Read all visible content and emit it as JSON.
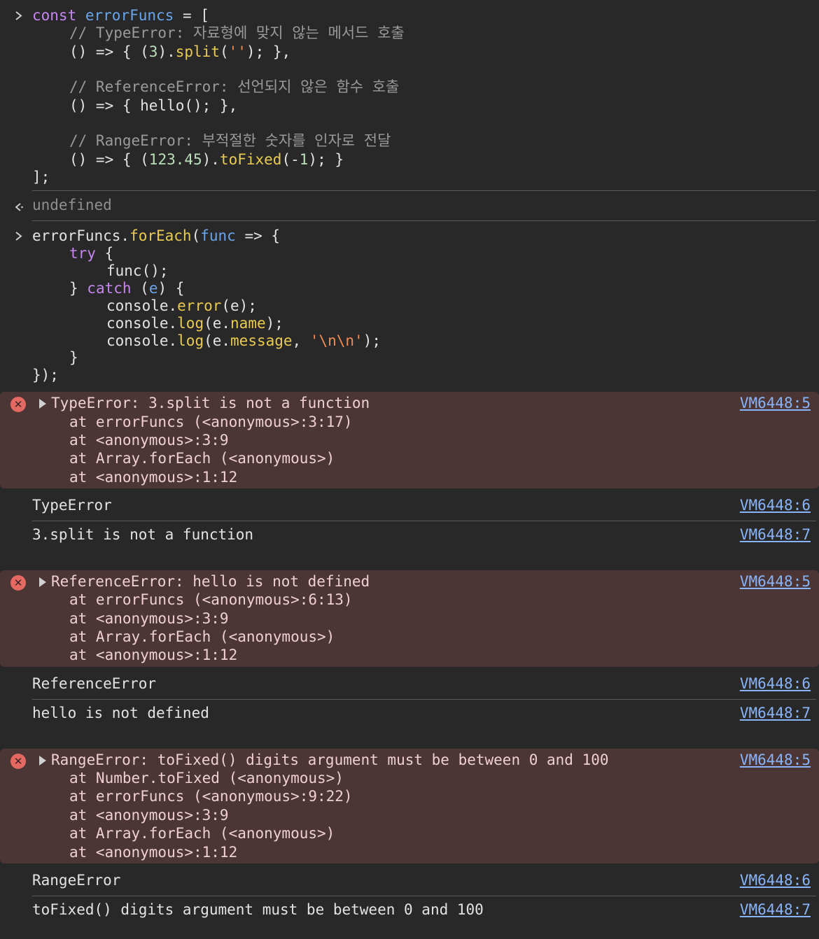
{
  "input1": {
    "const_kw": "const",
    "var_name": "errorFuncs",
    "assign": " = [",
    "comment1": "// TypeError: 자료형에 맞지 않는 메서드 호출",
    "line1_a": "() => { (",
    "line1_num": "3",
    "line1_b": ").",
    "line1_fn": "split",
    "line1_c": "(",
    "line1_str": "''",
    "line1_d": "); },",
    "comment2": "// ReferenceError: 선언되지 않은 함수 호출",
    "line2": "() => { hello(); },",
    "comment3": "// RangeError: 부적절한 숫자를 인자로 전달",
    "line3_a": "() => { (",
    "line3_num": "123.45",
    "line3_b": ").",
    "line3_fn": "toFixed",
    "line3_c": "(-",
    "line3_num2": "1",
    "line3_d": "); }",
    "close": "];"
  },
  "result1": "undefined",
  "input2": {
    "l1_a": "errorFuncs.",
    "l1_fn": "forEach",
    "l1_b": "(",
    "l1_var": "func",
    "l1_c": " => {",
    "l2_kw": "try",
    "l2_b": " {",
    "l3": "func();",
    "l4_a": "} ",
    "l4_kw": "catch",
    "l4_b": " (",
    "l4_var": "e",
    "l4_c": ") {",
    "l5_a": "console.",
    "l5_fn": "error",
    "l5_b": "(e);",
    "l6_a": "console.",
    "l6_fn": "log",
    "l6_b": "(e.",
    "l6_prop": "name",
    "l6_c": ");",
    "l7_a": "console.",
    "l7_fn": "log",
    "l7_b": "(e.",
    "l7_prop": "message",
    "l7_c": ", ",
    "l7_str": "'\\n\\n'",
    "l7_d": ");",
    "l8": "}",
    "l9": "});"
  },
  "errors": [
    {
      "title": "TypeError: 3.split is not a function",
      "stack": [
        "at errorFuncs (<anonymous>:3:17)",
        "at <anonymous>:3:9",
        "at Array.forEach (<anonymous>)",
        "at <anonymous>:1:12"
      ],
      "source": "VM6448:5",
      "name_log": "TypeError",
      "name_source": "VM6448:6",
      "message_log": "3.split is not a function",
      "message_source": "VM6448:7"
    },
    {
      "title": "ReferenceError: hello is not defined",
      "stack": [
        "at errorFuncs (<anonymous>:6:13)",
        "at <anonymous>:3:9",
        "at Array.forEach (<anonymous>)",
        "at <anonymous>:1:12"
      ],
      "source": "VM6448:5",
      "name_log": "ReferenceError",
      "name_source": "VM6448:6",
      "message_log": "hello is not defined",
      "message_source": "VM6448:7"
    },
    {
      "title": "RangeError: toFixed() digits argument must be between 0 and 100",
      "stack": [
        "at Number.toFixed (<anonymous>)",
        "at errorFuncs (<anonymous>:9:22)",
        "at <anonymous>:3:9",
        "at Array.forEach (<anonymous>)",
        "at <anonymous>:1:12"
      ],
      "source": "VM6448:5",
      "name_log": "RangeError",
      "name_source": "VM6448:6",
      "message_log": "toFixed() digits argument must be between 0 and 100",
      "message_source": "VM6448:7"
    }
  ],
  "icons": {
    "input_prompt": "chevron-right-icon",
    "result_prompt": "return-arrow-icon",
    "error": "error-circle-icon",
    "expand": "expand-triangle-icon"
  },
  "colors": {
    "background": "#282828",
    "error_background": "#4b3535",
    "keyword": "#c586f0",
    "variable": "#6aa5ec",
    "function": "#eacb50",
    "number": "#b9e0b8",
    "string": "#f28b54",
    "link": "#8ab4f8"
  }
}
